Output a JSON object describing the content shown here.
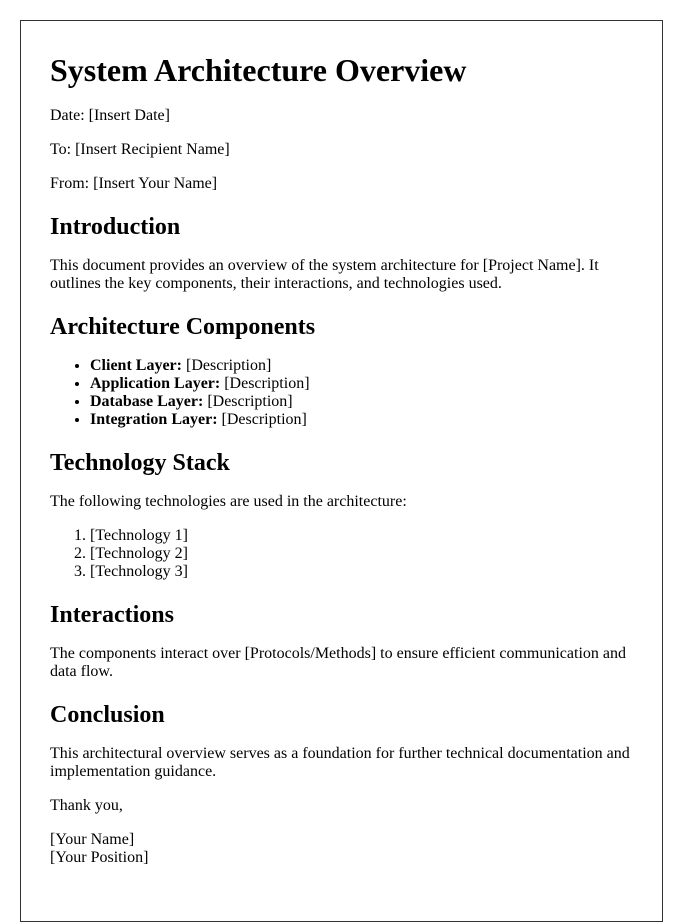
{
  "title": "System Architecture Overview",
  "meta": {
    "date": "Date: [Insert Date]",
    "to": "To: [Insert Recipient Name]",
    "from": "From: [Insert Your Name]"
  },
  "introduction": {
    "heading": "Introduction",
    "text": "This document provides an overview of the system architecture for [Project Name]. It outlines the key components, their interactions, and technologies used."
  },
  "components": {
    "heading": "Architecture Components",
    "items": [
      {
        "label": "Client Layer:",
        "desc": " [Description]"
      },
      {
        "label": "Application Layer:",
        "desc": " [Description]"
      },
      {
        "label": "Database Layer:",
        "desc": " [Description]"
      },
      {
        "label": "Integration Layer:",
        "desc": " [Description]"
      }
    ]
  },
  "technology": {
    "heading": "Technology Stack",
    "text": "The following technologies are used in the architecture:",
    "items": [
      "[Technology 1]",
      "[Technology 2]",
      "[Technology 3]"
    ]
  },
  "interactions": {
    "heading": "Interactions",
    "text": "The components interact over [Protocols/Methods] to ensure efficient communication and data flow."
  },
  "conclusion": {
    "heading": "Conclusion",
    "text": "This architectural overview serves as a foundation for further technical documentation and implementation guidance."
  },
  "closing": {
    "thanks": "Thank you,",
    "name": "[Your Name]",
    "position": "[Your Position]"
  }
}
